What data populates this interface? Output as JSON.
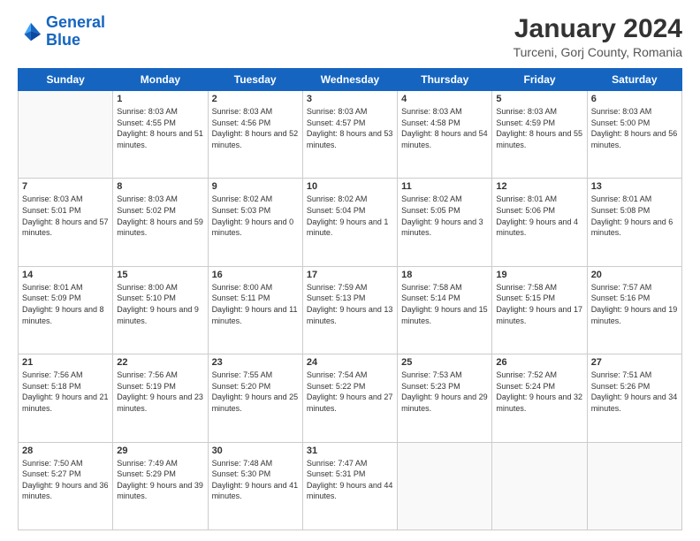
{
  "logo": {
    "line1": "General",
    "line2": "Blue"
  },
  "title": "January 2024",
  "subtitle": "Turceni, Gorj County, Romania",
  "weekdays": [
    "Sunday",
    "Monday",
    "Tuesday",
    "Wednesday",
    "Thursday",
    "Friday",
    "Saturday"
  ],
  "weeks": [
    [
      {
        "day": "",
        "sunrise": "",
        "sunset": "",
        "daylight": ""
      },
      {
        "day": "1",
        "sunrise": "Sunrise: 8:03 AM",
        "sunset": "Sunset: 4:55 PM",
        "daylight": "Daylight: 8 hours and 51 minutes."
      },
      {
        "day": "2",
        "sunrise": "Sunrise: 8:03 AM",
        "sunset": "Sunset: 4:56 PM",
        "daylight": "Daylight: 8 hours and 52 minutes."
      },
      {
        "day": "3",
        "sunrise": "Sunrise: 8:03 AM",
        "sunset": "Sunset: 4:57 PM",
        "daylight": "Daylight: 8 hours and 53 minutes."
      },
      {
        "day": "4",
        "sunrise": "Sunrise: 8:03 AM",
        "sunset": "Sunset: 4:58 PM",
        "daylight": "Daylight: 8 hours and 54 minutes."
      },
      {
        "day": "5",
        "sunrise": "Sunrise: 8:03 AM",
        "sunset": "Sunset: 4:59 PM",
        "daylight": "Daylight: 8 hours and 55 minutes."
      },
      {
        "day": "6",
        "sunrise": "Sunrise: 8:03 AM",
        "sunset": "Sunset: 5:00 PM",
        "daylight": "Daylight: 8 hours and 56 minutes."
      }
    ],
    [
      {
        "day": "7",
        "sunrise": "Sunrise: 8:03 AM",
        "sunset": "Sunset: 5:01 PM",
        "daylight": "Daylight: 8 hours and 57 minutes."
      },
      {
        "day": "8",
        "sunrise": "Sunrise: 8:03 AM",
        "sunset": "Sunset: 5:02 PM",
        "daylight": "Daylight: 8 hours and 59 minutes."
      },
      {
        "day": "9",
        "sunrise": "Sunrise: 8:02 AM",
        "sunset": "Sunset: 5:03 PM",
        "daylight": "Daylight: 9 hours and 0 minutes."
      },
      {
        "day": "10",
        "sunrise": "Sunrise: 8:02 AM",
        "sunset": "Sunset: 5:04 PM",
        "daylight": "Daylight: 9 hours and 1 minute."
      },
      {
        "day": "11",
        "sunrise": "Sunrise: 8:02 AM",
        "sunset": "Sunset: 5:05 PM",
        "daylight": "Daylight: 9 hours and 3 minutes."
      },
      {
        "day": "12",
        "sunrise": "Sunrise: 8:01 AM",
        "sunset": "Sunset: 5:06 PM",
        "daylight": "Daylight: 9 hours and 4 minutes."
      },
      {
        "day": "13",
        "sunrise": "Sunrise: 8:01 AM",
        "sunset": "Sunset: 5:08 PM",
        "daylight": "Daylight: 9 hours and 6 minutes."
      }
    ],
    [
      {
        "day": "14",
        "sunrise": "Sunrise: 8:01 AM",
        "sunset": "Sunset: 5:09 PM",
        "daylight": "Daylight: 9 hours and 8 minutes."
      },
      {
        "day": "15",
        "sunrise": "Sunrise: 8:00 AM",
        "sunset": "Sunset: 5:10 PM",
        "daylight": "Daylight: 9 hours and 9 minutes."
      },
      {
        "day": "16",
        "sunrise": "Sunrise: 8:00 AM",
        "sunset": "Sunset: 5:11 PM",
        "daylight": "Daylight: 9 hours and 11 minutes."
      },
      {
        "day": "17",
        "sunrise": "Sunrise: 7:59 AM",
        "sunset": "Sunset: 5:13 PM",
        "daylight": "Daylight: 9 hours and 13 minutes."
      },
      {
        "day": "18",
        "sunrise": "Sunrise: 7:58 AM",
        "sunset": "Sunset: 5:14 PM",
        "daylight": "Daylight: 9 hours and 15 minutes."
      },
      {
        "day": "19",
        "sunrise": "Sunrise: 7:58 AM",
        "sunset": "Sunset: 5:15 PM",
        "daylight": "Daylight: 9 hours and 17 minutes."
      },
      {
        "day": "20",
        "sunrise": "Sunrise: 7:57 AM",
        "sunset": "Sunset: 5:16 PM",
        "daylight": "Daylight: 9 hours and 19 minutes."
      }
    ],
    [
      {
        "day": "21",
        "sunrise": "Sunrise: 7:56 AM",
        "sunset": "Sunset: 5:18 PM",
        "daylight": "Daylight: 9 hours and 21 minutes."
      },
      {
        "day": "22",
        "sunrise": "Sunrise: 7:56 AM",
        "sunset": "Sunset: 5:19 PM",
        "daylight": "Daylight: 9 hours and 23 minutes."
      },
      {
        "day": "23",
        "sunrise": "Sunrise: 7:55 AM",
        "sunset": "Sunset: 5:20 PM",
        "daylight": "Daylight: 9 hours and 25 minutes."
      },
      {
        "day": "24",
        "sunrise": "Sunrise: 7:54 AM",
        "sunset": "Sunset: 5:22 PM",
        "daylight": "Daylight: 9 hours and 27 minutes."
      },
      {
        "day": "25",
        "sunrise": "Sunrise: 7:53 AM",
        "sunset": "Sunset: 5:23 PM",
        "daylight": "Daylight: 9 hours and 29 minutes."
      },
      {
        "day": "26",
        "sunrise": "Sunrise: 7:52 AM",
        "sunset": "Sunset: 5:24 PM",
        "daylight": "Daylight: 9 hours and 32 minutes."
      },
      {
        "day": "27",
        "sunrise": "Sunrise: 7:51 AM",
        "sunset": "Sunset: 5:26 PM",
        "daylight": "Daylight: 9 hours and 34 minutes."
      }
    ],
    [
      {
        "day": "28",
        "sunrise": "Sunrise: 7:50 AM",
        "sunset": "Sunset: 5:27 PM",
        "daylight": "Daylight: 9 hours and 36 minutes."
      },
      {
        "day": "29",
        "sunrise": "Sunrise: 7:49 AM",
        "sunset": "Sunset: 5:29 PM",
        "daylight": "Daylight: 9 hours and 39 minutes."
      },
      {
        "day": "30",
        "sunrise": "Sunrise: 7:48 AM",
        "sunset": "Sunset: 5:30 PM",
        "daylight": "Daylight: 9 hours and 41 minutes."
      },
      {
        "day": "31",
        "sunrise": "Sunrise: 7:47 AM",
        "sunset": "Sunset: 5:31 PM",
        "daylight": "Daylight: 9 hours and 44 minutes."
      },
      {
        "day": "",
        "sunrise": "",
        "sunset": "",
        "daylight": ""
      },
      {
        "day": "",
        "sunrise": "",
        "sunset": "",
        "daylight": ""
      },
      {
        "day": "",
        "sunrise": "",
        "sunset": "",
        "daylight": ""
      }
    ]
  ]
}
